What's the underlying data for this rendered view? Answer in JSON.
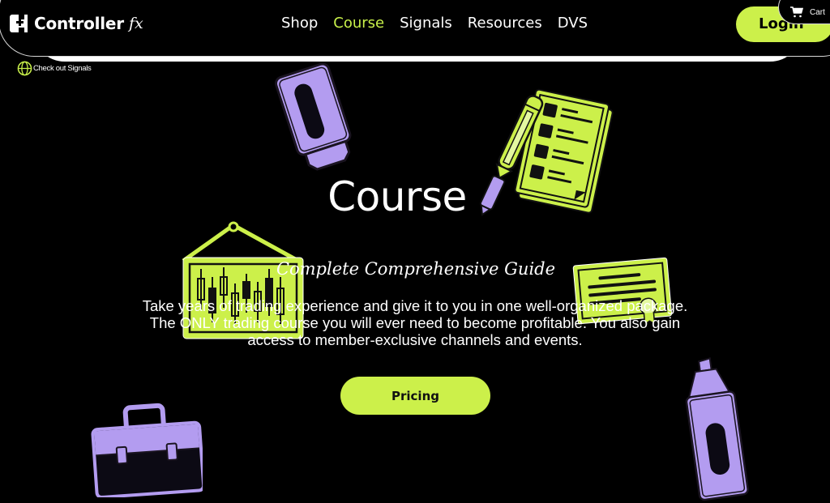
{
  "header": {
    "brand_name": "Controller",
    "brand_suffix": "fx",
    "nav": [
      {
        "label": "Shop",
        "active": false
      },
      {
        "label": "Course",
        "active": true
      },
      {
        "label": "Signals",
        "active": false
      },
      {
        "label": "Resources",
        "active": false
      },
      {
        "label": "DVS",
        "active": false
      }
    ],
    "login_label": "Login",
    "cart_label": "Cart",
    "signals_link_label": "Check out Signals"
  },
  "hero": {
    "title": "Course",
    "subtitle": "Complete Comprehensive Guide",
    "description": "Take years of trading experience and give it to you in one well-organized package. The ONLY trading course you will ever need to become profitable. You also gain access to member-exclusive channels and events.",
    "cta_label": "Pricing"
  },
  "colors": {
    "accent_green": "#ccf04a",
    "accent_purple": "#b39cf0",
    "background": "#000000"
  },
  "illustrations": [
    "marker-cap-icon",
    "checklist-with-pencil-icon",
    "candlestick-chart-sign-icon",
    "certificate-icon",
    "briefcase-icon",
    "highlighter-icon"
  ]
}
